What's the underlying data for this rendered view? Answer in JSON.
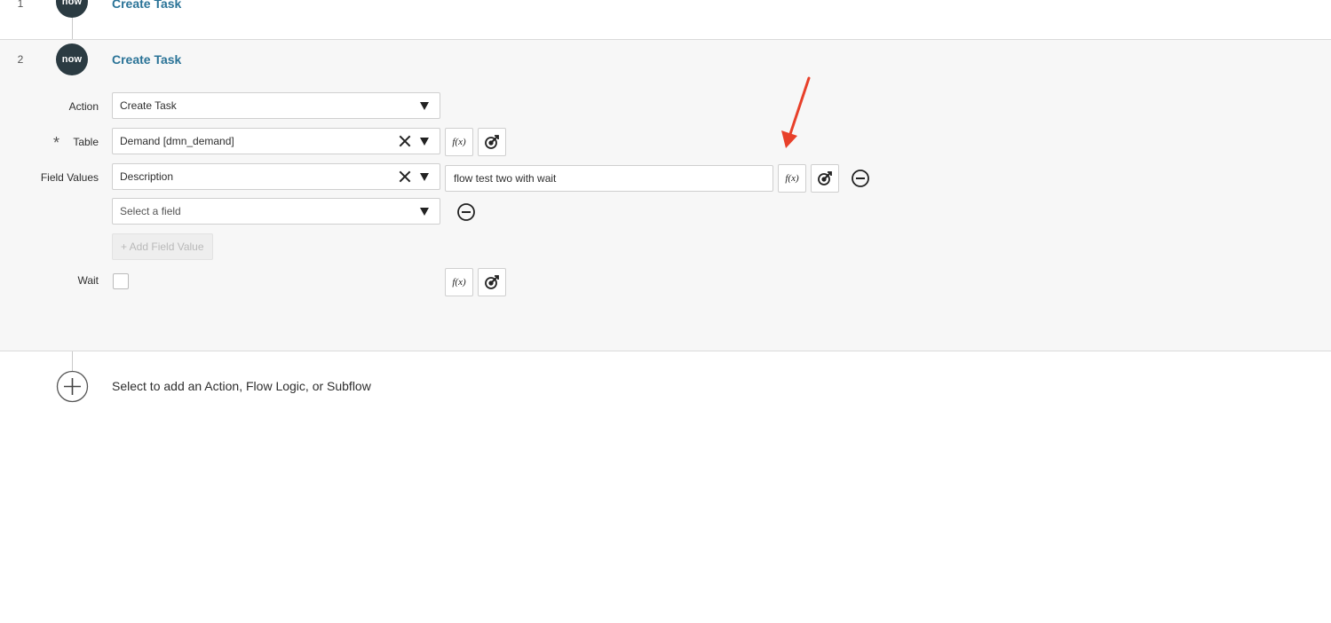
{
  "steps": [
    {
      "number": "1",
      "badge": "now",
      "title": "Create Task"
    },
    {
      "number": "2",
      "badge": "now",
      "title": "Create Task"
    }
  ],
  "form": {
    "action": {
      "label": "Action",
      "value": "Create Task"
    },
    "table": {
      "required_mark": "*",
      "label": "Table",
      "value": "Demand [dmn_demand]"
    },
    "field_values": {
      "label": "Field Values",
      "field": "Description",
      "value": "flow test two with wait",
      "new_field_placeholder": "Select a field",
      "add_button": "+ Add Field Value"
    },
    "wait": {
      "label": "Wait",
      "checked": false
    },
    "fx_label": "f(x)"
  },
  "add_step": {
    "hint": "Select to add an Action, Flow Logic, or Subflow"
  },
  "colors": {
    "accent_title": "#2a7397",
    "badge_bg": "#2b3b42",
    "annotation_arrow": "#e8402a"
  }
}
